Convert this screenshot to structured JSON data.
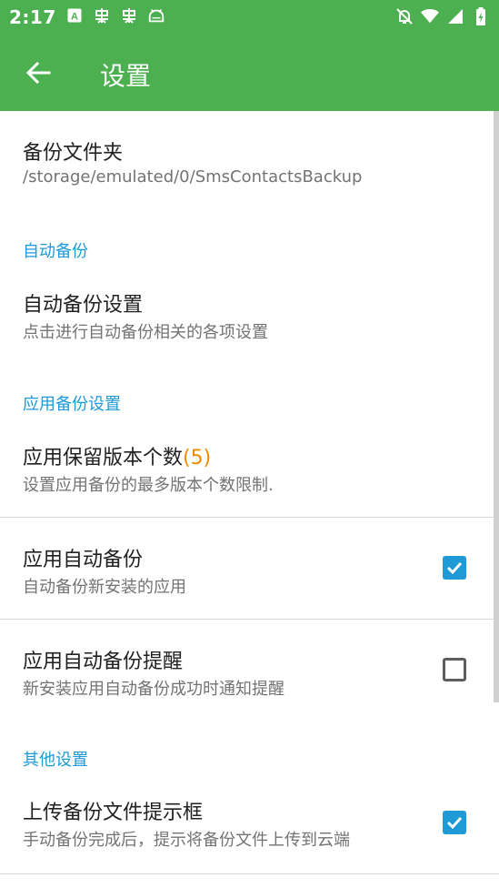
{
  "status": {
    "time": "2:17",
    "icons": [
      "font-a-icon",
      "bug-icon",
      "bug-icon",
      "android-icon"
    ],
    "right_icons": [
      "notifications-off-icon",
      "wifi-icon",
      "signal-icon",
      "battery-icon"
    ]
  },
  "appbar": {
    "title": "设置",
    "color": "#4caf50"
  },
  "settings": {
    "backup_folder": {
      "title": "备份文件夹",
      "summary": "/storage/emulated/0/SmsContactsBackup"
    },
    "cat_auto_backup": "自动备份",
    "auto_backup_settings": {
      "title": "自动备份设置",
      "summary": "点击进行自动备份相关的各项设置"
    },
    "cat_app_backup": "应用备份设置",
    "app_keep_versions": {
      "title": "应用保留版本个数",
      "value": "(5)",
      "summary": "设置应用备份的最多版本个数限制."
    },
    "app_auto_backup": {
      "title": "应用自动备份",
      "summary": "自动备份新安装的应用",
      "checked": true
    },
    "app_auto_backup_notify": {
      "title": "应用自动备份提醒",
      "summary": "新安装应用自动备份成功时通知提醒",
      "checked": false
    },
    "cat_other": "其他设置",
    "upload_prompt": {
      "title": "上传备份文件提示框",
      "summary": "手动备份完成后，提示将备份文件上传到云端",
      "checked": true
    }
  },
  "colors": {
    "accent": "#1e9ad6",
    "highlight": "#f08c00"
  }
}
